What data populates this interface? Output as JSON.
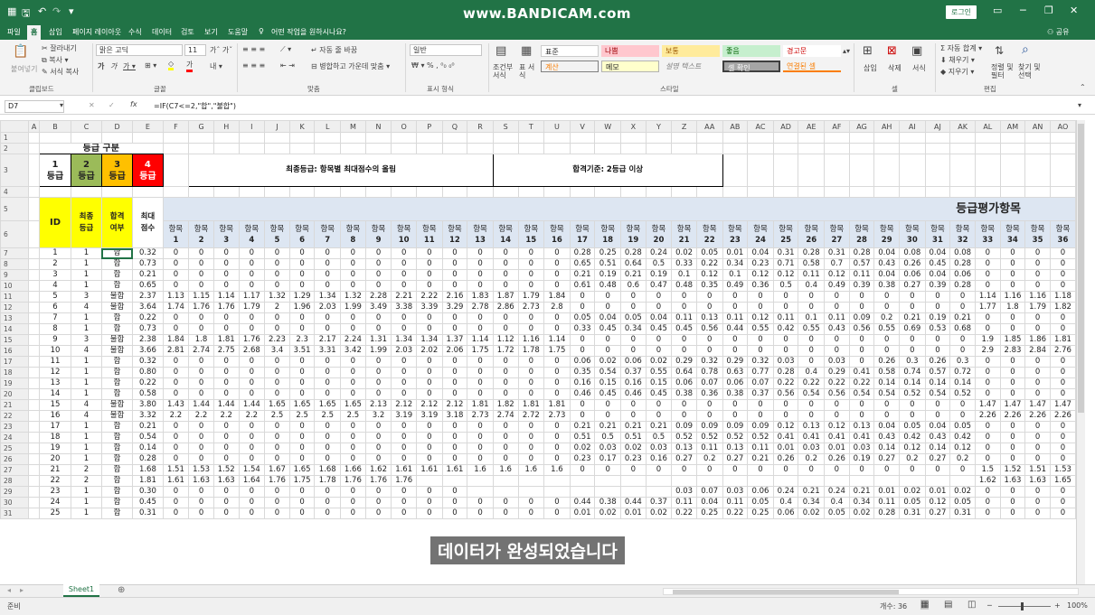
{
  "titlebar": {
    "watermark": "www.BANDICAM.com",
    "login": "로그인"
  },
  "tabs": [
    "파일",
    "홈",
    "삽입",
    "페이지 레이아웃",
    "수식",
    "데이터",
    "검토",
    "보기",
    "도움말"
  ],
  "tell_me": "어떤 작업을 원하시나요?",
  "share": "공유",
  "ribbon": {
    "paste": "붙여넣기",
    "cut": "잘라내기",
    "copy": "복사",
    "format_painter": "서식 복사",
    "clipboard": "클립보드",
    "font_name": "맑은 고딕",
    "font_size": "11",
    "font": "글꼴",
    "wrap": "자동 줄 바꿈",
    "merge": "병합하고 가운데 맞춤",
    "align": "맞춤",
    "number_format": "일반",
    "number": "표시 형식",
    "cond_format": "조건부 서식",
    "table_format": "표 서식",
    "styles": [
      "표준",
      "나쁨",
      "보통",
      "좋음",
      "경고문",
      "계산",
      "메모",
      "설명 텍스트",
      "셀 확인",
      "연결된 셀"
    ],
    "style": "스타일",
    "insert": "삽입",
    "delete": "삭제",
    "format": "서식",
    "cells": "셀",
    "autosum": "자동 합계",
    "fill": "채우기",
    "clear": "지우기",
    "sort": "정렬 및 필터",
    "find": "찾기 및 선택",
    "edit": "편집"
  },
  "formula_bar": {
    "cell": "D7",
    "formula": "=IF(C7<=2,\"합\",\"불합\")"
  },
  "col_letters": [
    "A",
    "B",
    "C",
    "D",
    "E",
    "F",
    "G",
    "H",
    "I",
    "J",
    "K",
    "L",
    "M",
    "N",
    "O",
    "P",
    "Q",
    "R",
    "S",
    "T",
    "U",
    "V",
    "W",
    "X",
    "Y",
    "Z",
    "AA",
    "AB",
    "AC",
    "AD",
    "AE",
    "AF",
    "AG",
    "AH",
    "AI",
    "AJ",
    "AK",
    "AL",
    "AM",
    "AN",
    "AO"
  ],
  "sheet": {
    "grade_title": "등급 구분",
    "grades": [
      "1\n등급",
      "2\n등급",
      "3\n등급",
      "4\n등급"
    ],
    "banner1": "최종등급: 항목별 최대점수의 올림",
    "banner2": "합격기준: 2등급 이상",
    "eval_header": "등급평가항목",
    "h_id": "ID",
    "h_final": "최종\n등급",
    "h_pass": "합격\n여부",
    "h_max": "최대\n점수",
    "item_label": "항목",
    "items": [
      "1",
      "2",
      "3",
      "4",
      "5",
      "6",
      "7",
      "8",
      "9",
      "10",
      "11",
      "12",
      "13",
      "14",
      "15",
      "16",
      "17",
      "18",
      "19",
      "20",
      "21",
      "22",
      "23",
      "24",
      "25",
      "26",
      "27",
      "28",
      "29",
      "30",
      "31",
      "32",
      "33",
      "34",
      "35",
      "36"
    ],
    "rows": [
      [
        "1",
        "1",
        "합",
        "0.32",
        [
          "0",
          "0",
          "0",
          "0",
          "0",
          "0",
          "0",
          "0",
          "0",
          "0",
          "0",
          "0",
          "0",
          "0",
          "0",
          "0",
          "0.28",
          "0.25",
          "0.28",
          "0.24",
          "0.02",
          "0.05",
          "0.01",
          "0.04",
          "0.31",
          "0.28",
          "0.31",
          "0.28",
          "0.04",
          "0.08",
          "0.04",
          "0.08",
          "0",
          "0",
          "0",
          "0"
        ]
      ],
      [
        "2",
        "1",
        "합",
        "0.73",
        [
          "0",
          "0",
          "0",
          "0",
          "0",
          "0",
          "0",
          "0",
          "0",
          "0",
          "0",
          "0",
          "0",
          "0",
          "0",
          "0",
          "0.65",
          "0.51",
          "0.64",
          "0.5",
          "0.33",
          "0.22",
          "0.34",
          "0.23",
          "0.71",
          "0.58",
          "0.7",
          "0.57",
          "0.43",
          "0.26",
          "0.45",
          "0.28",
          "0",
          "0",
          "0",
          "0"
        ]
      ],
      [
        "3",
        "1",
        "합",
        "0.21",
        [
          "0",
          "0",
          "0",
          "0",
          "0",
          "0",
          "0",
          "0",
          "0",
          "0",
          "0",
          "0",
          "0",
          "0",
          "0",
          "0",
          "0.21",
          "0.19",
          "0.21",
          "0.19",
          "0.1",
          "0.12",
          "0.1",
          "0.12",
          "0.12",
          "0.11",
          "0.12",
          "0.11",
          "0.04",
          "0.06",
          "0.04",
          "0.06",
          "0",
          "0",
          "0",
          "0"
        ]
      ],
      [
        "4",
        "1",
        "합",
        "0.65",
        [
          "0",
          "0",
          "0",
          "0",
          "0",
          "0",
          "0",
          "0",
          "0",
          "0",
          "0",
          "0",
          "0",
          "0",
          "0",
          "0",
          "0.61",
          "0.48",
          "0.6",
          "0.47",
          "0.48",
          "0.35",
          "0.49",
          "0.36",
          "0.5",
          "0.4",
          "0.49",
          "0.39",
          "0.38",
          "0.27",
          "0.39",
          "0.28",
          "0",
          "0",
          "0",
          "0"
        ]
      ],
      [
        "5",
        "3",
        "불합",
        "2.37",
        [
          "1.13",
          "1.15",
          "1.14",
          "1.17",
          "1.32",
          "1.29",
          "1.34",
          "1.32",
          "2.28",
          "2.21",
          "2.22",
          "2.16",
          "1.83",
          "1.87",
          "1.79",
          "1.84",
          "0",
          "0",
          "0",
          "0",
          "0",
          "0",
          "0",
          "0",
          "0",
          "0",
          "0",
          "0",
          "0",
          "0",
          "0",
          "0",
          "1.14",
          "1.16",
          "1.16",
          "1.18"
        ]
      ],
      [
        "6",
        "4",
        "불합",
        "3.64",
        [
          "1.74",
          "1.76",
          "1.76",
          "1.79",
          "2",
          "1.96",
          "2.03",
          "1.99",
          "3.49",
          "3.38",
          "3.39",
          "3.29",
          "2.78",
          "2.86",
          "2.73",
          "2.8",
          "0",
          "0",
          "0",
          "0",
          "0",
          "0",
          "0",
          "0",
          "0",
          "0",
          "0",
          "0",
          "0",
          "0",
          "0",
          "0",
          "1.77",
          "1.8",
          "1.79",
          "1.82"
        ]
      ],
      [
        "7",
        "1",
        "합",
        "0.22",
        [
          "0",
          "0",
          "0",
          "0",
          "0",
          "0",
          "0",
          "0",
          "0",
          "0",
          "0",
          "0",
          "0",
          "0",
          "0",
          "0",
          "0.05",
          "0.04",
          "0.05",
          "0.04",
          "0.11",
          "0.13",
          "0.11",
          "0.12",
          "0.11",
          "0.1",
          "0.11",
          "0.09",
          "0.2",
          "0.21",
          "0.19",
          "0.21",
          "0",
          "0",
          "0",
          "0"
        ]
      ],
      [
        "8",
        "1",
        "합",
        "0.73",
        [
          "0",
          "0",
          "0",
          "0",
          "0",
          "0",
          "0",
          "0",
          "0",
          "0",
          "0",
          "0",
          "0",
          "0",
          "0",
          "0",
          "0.33",
          "0.45",
          "0.34",
          "0.45",
          "0.45",
          "0.56",
          "0.44",
          "0.55",
          "0.42",
          "0.55",
          "0.43",
          "0.56",
          "0.55",
          "0.69",
          "0.53",
          "0.68",
          "0",
          "0",
          "0",
          "0"
        ]
      ],
      [
        "9",
        "3",
        "불합",
        "2.38",
        [
          "1.84",
          "1.8",
          "1.81",
          "1.76",
          "2.23",
          "2.3",
          "2.17",
          "2.24",
          "1.31",
          "1.34",
          "1.34",
          "1.37",
          "1.14",
          "1.12",
          "1.16",
          "1.14",
          "0",
          "0",
          "0",
          "0",
          "0",
          "0",
          "0",
          "0",
          "0",
          "0",
          "0",
          "0",
          "0",
          "0",
          "0",
          "0",
          "1.9",
          "1.85",
          "1.86",
          "1.81"
        ]
      ],
      [
        "10",
        "4",
        "불합",
        "3.66",
        [
          "2.81",
          "2.74",
          "2.75",
          "2.68",
          "3.4",
          "3.51",
          "3.31",
          "3.42",
          "1.99",
          "2.03",
          "2.02",
          "2.06",
          "1.75",
          "1.72",
          "1.78",
          "1.75",
          "0",
          "0",
          "0",
          "0",
          "0",
          "0",
          "0",
          "0",
          "0",
          "0",
          "0",
          "0",
          "0",
          "0",
          "0",
          "0",
          "2.9",
          "2.83",
          "2.84",
          "2.76"
        ]
      ],
      [
        "11",
        "1",
        "합",
        "0.32",
        [
          "0",
          "0",
          "0",
          "0",
          "0",
          "0",
          "0",
          "0",
          "0",
          "0",
          "0",
          "0",
          "0",
          "0",
          "0",
          "0",
          "0.06",
          "0.02",
          "0.06",
          "0.02",
          "0.29",
          "0.32",
          "0.29",
          "0.32",
          "0.03",
          "0",
          "0.03",
          "0",
          "0.26",
          "0.3",
          "0.26",
          "0.3",
          "0",
          "0",
          "0",
          "0"
        ]
      ],
      [
        "12",
        "1",
        "합",
        "0.80",
        [
          "0",
          "0",
          "0",
          "0",
          "0",
          "0",
          "0",
          "0",
          "0",
          "0",
          "0",
          "0",
          "0",
          "0",
          "0",
          "0",
          "0.35",
          "0.54",
          "0.37",
          "0.55",
          "0.64",
          "0.78",
          "0.63",
          "0.77",
          "0.28",
          "0.4",
          "0.29",
          "0.41",
          "0.58",
          "0.74",
          "0.57",
          "0.72",
          "0",
          "0",
          "0",
          "0"
        ]
      ],
      [
        "13",
        "1",
        "합",
        "0.22",
        [
          "0",
          "0",
          "0",
          "0",
          "0",
          "0",
          "0",
          "0",
          "0",
          "0",
          "0",
          "0",
          "0",
          "0",
          "0",
          "0",
          "0.16",
          "0.15",
          "0.16",
          "0.15",
          "0.06",
          "0.07",
          "0.06",
          "0.07",
          "0.22",
          "0.22",
          "0.22",
          "0.22",
          "0.14",
          "0.14",
          "0.14",
          "0.14",
          "0",
          "0",
          "0",
          "0"
        ]
      ],
      [
        "14",
        "1",
        "합",
        "0.58",
        [
          "0",
          "0",
          "0",
          "0",
          "0",
          "0",
          "0",
          "0",
          "0",
          "0",
          "0",
          "0",
          "0",
          "0",
          "0",
          "0",
          "0.46",
          "0.45",
          "0.46",
          "0.45",
          "0.38",
          "0.36",
          "0.38",
          "0.37",
          "0.56",
          "0.54",
          "0.56",
          "0.54",
          "0.54",
          "0.52",
          "0.54",
          "0.52",
          "0",
          "0",
          "0",
          "0"
        ]
      ],
      [
        "15",
        "4",
        "불합",
        "3.80",
        [
          "1.43",
          "1.44",
          "1.44",
          "1.44",
          "1.65",
          "1.65",
          "1.65",
          "1.65",
          "2.13",
          "2.12",
          "2.12",
          "2.12",
          "1.81",
          "1.82",
          "1.81",
          "1.81",
          "0",
          "0",
          "0",
          "0",
          "0",
          "0",
          "0",
          "0",
          "0",
          "0",
          "0",
          "0",
          "0",
          "0",
          "0",
          "0",
          "1.47",
          "1.47",
          "1.47",
          "1.47"
        ]
      ],
      [
        "16",
        "4",
        "불합",
        "3.32",
        [
          "2.2",
          "2.2",
          "2.2",
          "2.2",
          "2.5",
          "2.5",
          "2.5",
          "2.5",
          "3.2",
          "3.19",
          "3.19",
          "3.18",
          "2.73",
          "2.74",
          "2.72",
          "2.73",
          "0",
          "0",
          "0",
          "0",
          "0",
          "0",
          "0",
          "0",
          "0",
          "0",
          "0",
          "0",
          "0",
          "0",
          "0",
          "0",
          "2.26",
          "2.26",
          "2.26",
          "2.26"
        ]
      ],
      [
        "17",
        "1",
        "합",
        "0.21",
        [
          "0",
          "0",
          "0",
          "0",
          "0",
          "0",
          "0",
          "0",
          "0",
          "0",
          "0",
          "0",
          "0",
          "0",
          "0",
          "0",
          "0.21",
          "0.21",
          "0.21",
          "0.21",
          "0.09",
          "0.09",
          "0.09",
          "0.09",
          "0.12",
          "0.13",
          "0.12",
          "0.13",
          "0.04",
          "0.05",
          "0.04",
          "0.05",
          "0",
          "0",
          "0",
          "0"
        ]
      ],
      [
        "18",
        "1",
        "합",
        "0.54",
        [
          "0",
          "0",
          "0",
          "0",
          "0",
          "0",
          "0",
          "0",
          "0",
          "0",
          "0",
          "0",
          "0",
          "0",
          "0",
          "0",
          "0.51",
          "0.5",
          "0.51",
          "0.5",
          "0.52",
          "0.52",
          "0.52",
          "0.52",
          "0.41",
          "0.41",
          "0.41",
          "0.41",
          "0.43",
          "0.42",
          "0.43",
          "0.42",
          "0",
          "0",
          "0",
          "0"
        ]
      ],
      [
        "19",
        "1",
        "합",
        "0.14",
        [
          "0",
          "0",
          "0",
          "0",
          "0",
          "0",
          "0",
          "0",
          "0",
          "0",
          "0",
          "0",
          "0",
          "0",
          "0",
          "0",
          "0.02",
          "0.03",
          "0.02",
          "0.03",
          "0.13",
          "0.11",
          "0.13",
          "0.11",
          "0.01",
          "0.03",
          "0.01",
          "0.03",
          "0.14",
          "0.12",
          "0.14",
          "0.12",
          "0",
          "0",
          "0",
          "0"
        ]
      ],
      [
        "20",
        "1",
        "합",
        "0.28",
        [
          "0",
          "0",
          "0",
          "0",
          "0",
          "0",
          "0",
          "0",
          "0",
          "0",
          "0",
          "0",
          "0",
          "0",
          "0",
          "0",
          "0.23",
          "0.17",
          "0.23",
          "0.16",
          "0.27",
          "0.2",
          "0.27",
          "0.21",
          "0.26",
          "0.2",
          "0.26",
          "0.19",
          "0.27",
          "0.2",
          "0.27",
          "0.2",
          "0",
          "0",
          "0",
          "0"
        ]
      ],
      [
        "21",
        "2",
        "합",
        "1.68",
        [
          "1.51",
          "1.53",
          "1.52",
          "1.54",
          "1.67",
          "1.65",
          "1.68",
          "1.66",
          "1.62",
          "1.61",
          "1.61",
          "1.61",
          "1.6",
          "1.6",
          "1.6",
          "1.6",
          "0",
          "0",
          "0",
          "0",
          "0",
          "0",
          "0",
          "0",
          "0",
          "0",
          "0",
          "0",
          "0",
          "0",
          "0",
          "0",
          "1.5",
          "1.52",
          "1.51",
          "1.53"
        ]
      ],
      [
        "22",
        "2",
        "합",
        "1.81",
        [
          "1.61",
          "1.63",
          "1.63",
          "1.64",
          "1.76",
          "1.75",
          "1.78",
          "1.76",
          "1.76",
          "1.76",
          "",
          "",
          "",
          "",
          "",
          "",
          "",
          "",
          "",
          "",
          "",
          "",
          "",
          "",
          "",
          "",
          "",
          "",
          "",
          "",
          "",
          "",
          "1.62",
          "1.63",
          "1.63",
          "1.65"
        ]
      ],
      [
        "23",
        "1",
        "합",
        "0.30",
        [
          "0",
          "0",
          "0",
          "0",
          "0",
          "0",
          "0",
          "0",
          "0",
          "0",
          "0",
          "0",
          "",
          "",
          "",
          "",
          "",
          "",
          "",
          "",
          "0.03",
          "0.07",
          "0.03",
          "0.06",
          "0.24",
          "0.21",
          "0.24",
          "0.21",
          "0.01",
          "0.02",
          "0.01",
          "0.02",
          "0",
          "0",
          "0",
          "0"
        ]
      ],
      [
        "24",
        "1",
        "합",
        "0.45",
        [
          "0",
          "0",
          "0",
          "0",
          "0",
          "0",
          "0",
          "0",
          "0",
          "0",
          "0",
          "0",
          "0",
          "0",
          "0",
          "0",
          "0.44",
          "0.38",
          "0.44",
          "0.37",
          "0.11",
          "0.04",
          "0.11",
          "0.05",
          "0.4",
          "0.34",
          "0.4",
          "0.34",
          "0.11",
          "0.05",
          "0.12",
          "0.05",
          "0",
          "0",
          "0",
          "0"
        ]
      ],
      [
        "25",
        "1",
        "합",
        "0.31",
        [
          "0",
          "0",
          "0",
          "0",
          "0",
          "0",
          "0",
          "0",
          "0",
          "0",
          "0",
          "0",
          "0",
          "0",
          "0",
          "0",
          "0.01",
          "0.02",
          "0.01",
          "0.02",
          "0.22",
          "0.25",
          "0.22",
          "0.25",
          "0.06",
          "0.02",
          "0.05",
          "0.02",
          "0.28",
          "0.31",
          "0.27",
          "0.31",
          "0",
          "0",
          "0",
          "0"
        ]
      ]
    ]
  },
  "caption": "데이터가 완성되었습니다",
  "sheet_tab": "Sheet1",
  "status": {
    "ready": "준비",
    "count": "개수: 36",
    "zoom": "100%"
  }
}
